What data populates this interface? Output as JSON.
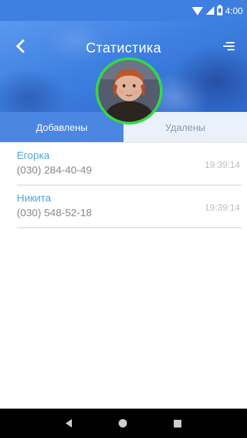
{
  "status_bar": {
    "time": "4:00"
  },
  "header": {
    "title": "Статистика"
  },
  "tabs": [
    {
      "label": "Добавлены",
      "active": true
    },
    {
      "label": "Удалены",
      "active": false
    }
  ],
  "list": [
    {
      "name": "Егорка",
      "phone": "(030) 284-40-49",
      "time": "19:39:14"
    },
    {
      "name": "Никита",
      "phone": "(030) 548-52-18",
      "time": "19:39:14"
    }
  ],
  "colors": {
    "header_blue": "#3f7fe1",
    "active_tab": "#4c86e3",
    "inactive_tab": "#eaf1fb",
    "avatar_ring": "#36d64b",
    "contact_name": "#4fa6e0"
  }
}
